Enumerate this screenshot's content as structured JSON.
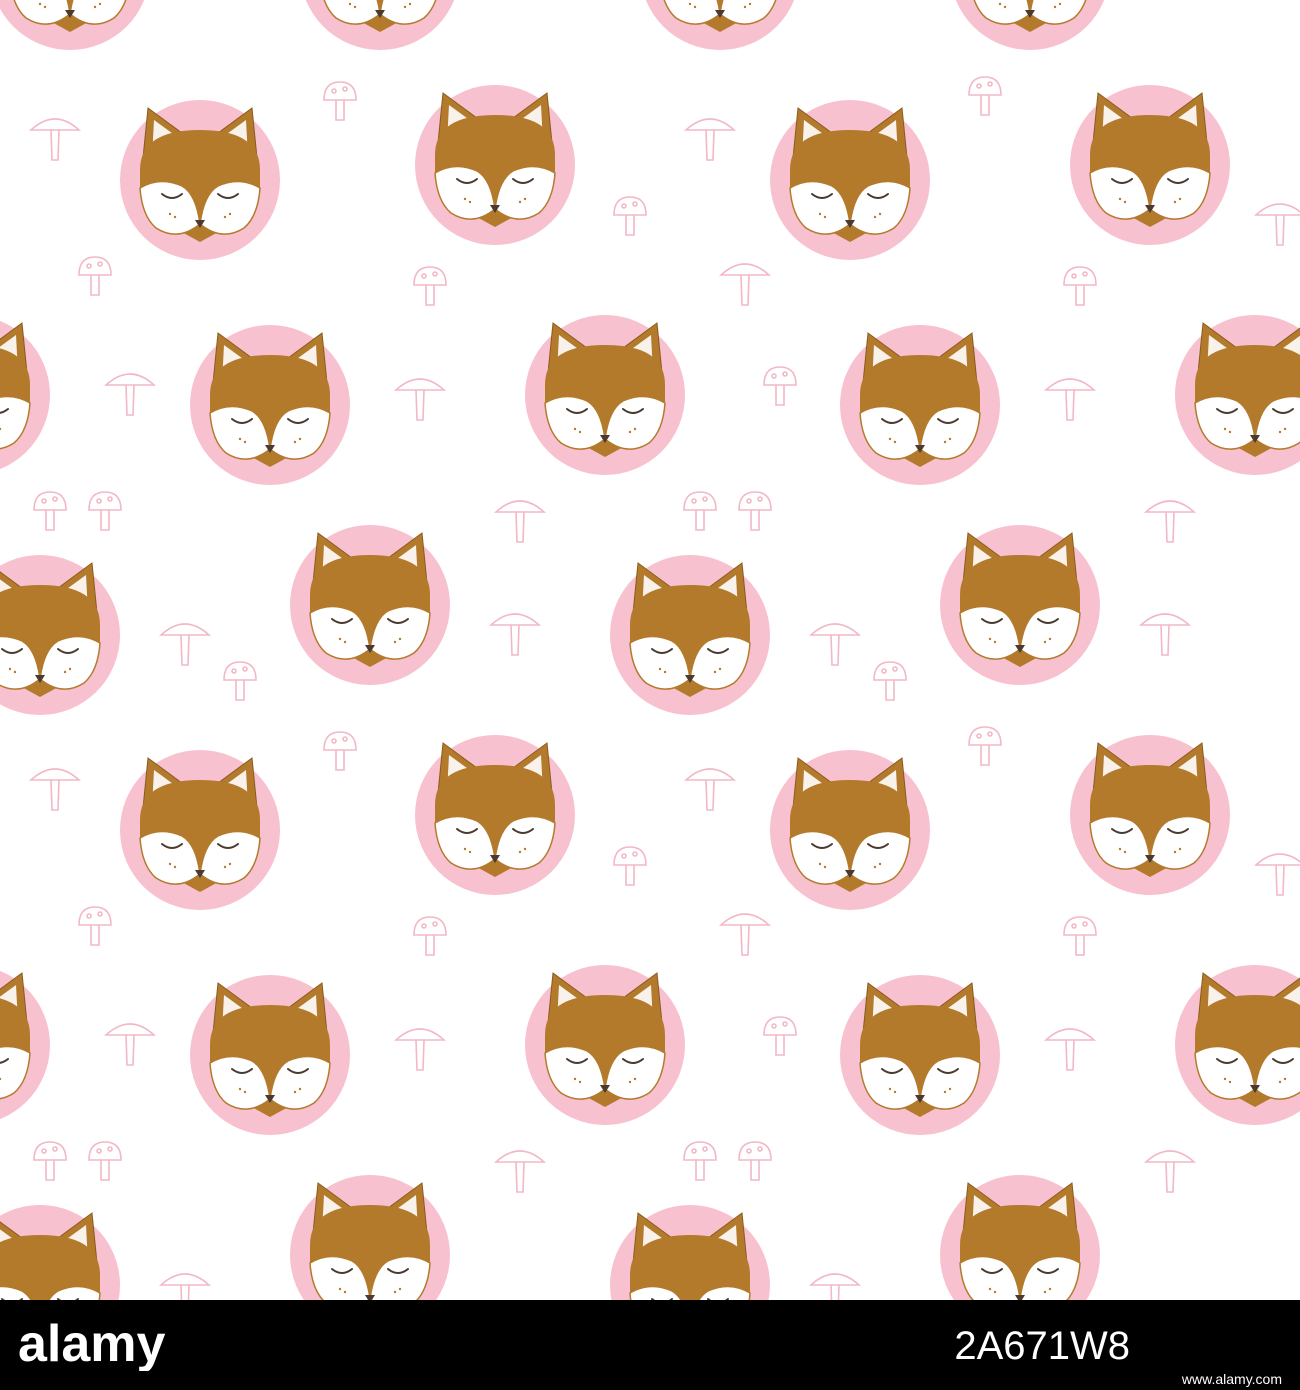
{
  "pattern": {
    "background": "#ffffff",
    "circle_color": "#f7c1cf",
    "fox_fur_color": "#b47a2c",
    "fox_face_color": "#ffffff",
    "line_color": "#4a3a30",
    "mushroom_outline_color": "#f2b8c6",
    "motifs": [
      "fox-face-icon",
      "mushroom-icon"
    ]
  },
  "watermark": {
    "logo": "alamy",
    "image_id": "2A671W8",
    "url": "www.alamy.com",
    "bar_color": "#000000",
    "text_color": "#ffffff"
  }
}
